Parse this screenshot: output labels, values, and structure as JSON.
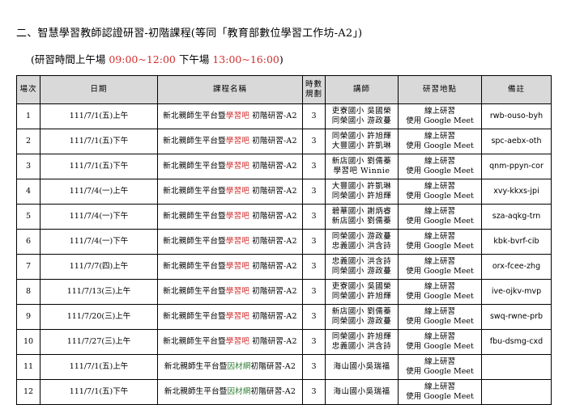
{
  "heading": "二、智慧學習教師認證研習-初階課程(等同「教育部數位學習工作坊-A2」)",
  "time_note": {
    "prefix": "(研習時間上午場 ",
    "morning": "09:00~12:00",
    "middle": " 下午場 ",
    "afternoon": "13:00~16:00",
    "suffix": ")"
  },
  "colors": {
    "red_text": "#d22d2d",
    "green_text": "#2e7d32",
    "header_bg": "#d9d9d9"
  },
  "table": {
    "headers": {
      "no": "場次",
      "date": "日期",
      "course": "課程名稱",
      "hours_1": "時數",
      "hours_2": "規劃",
      "teacher": "講師",
      "location": "研習地點",
      "note": "備註"
    },
    "rows": [
      {
        "no": "1",
        "date": "111/7/1(五)上午",
        "course_pre": "新北親師生平台暨",
        "course_kw": "學習吧",
        "course_post": " 初階研習-A2",
        "kw_color": "red",
        "hours": "3",
        "t1": "吏寮國小 吳國榮",
        "t2": "同榮國小 游政蔓",
        "l1": "線上研習",
        "l2": "使用 Google Meet",
        "note": "rwb-ouso-byh"
      },
      {
        "no": "2",
        "date": "111/7/1(五)下午",
        "course_pre": "新北親師生平台暨",
        "course_kw": "學習吧",
        "course_post": " 初階研習-A2",
        "kw_color": "red",
        "hours": "3",
        "t1": "同榮國小 許旭輝",
        "t2": "大豐國小 許凱琳",
        "l1": "線上研習",
        "l2": "使用 Google Meet",
        "note": "spc-aebx-oth"
      },
      {
        "no": "3",
        "date": "111/7/1(五)下午",
        "course_pre": "新北親師生平台暨",
        "course_kw": "學習吧",
        "course_post": " 初階研習-A2",
        "kw_color": "red",
        "hours": "3",
        "t1": "新店國小 劉儒蓁",
        "t2": "學習吧 Winnie",
        "l1": "線上研習",
        "l2": "使用 Google Meet",
        "note": "qnm-ppyn-cor"
      },
      {
        "no": "4",
        "date": "111/7/4(一)上午",
        "course_pre": "新北親師生平台暨",
        "course_kw": "學習吧",
        "course_post": " 初階研習-A2",
        "kw_color": "red",
        "hours": "3",
        "t1": "大豐國小 許凱琳",
        "t2": "同榮國小 許旭輝",
        "l1": "線上研習",
        "l2": "使用 Google Meet",
        "note": "xvy-kkxs-jpi"
      },
      {
        "no": "5",
        "date": "111/7/4(一)下午",
        "course_pre": "新北親師生平台暨",
        "course_kw": "學習吧",
        "course_post": " 初階研習-A2",
        "kw_color": "red",
        "hours": "3",
        "t1": "碧華國小 謝炳睿",
        "t2": "新店國小 劉儒蓁",
        "l1": "線上研習",
        "l2": "使用 Google Meet",
        "note": "sza-aqkg-trn"
      },
      {
        "no": "6",
        "date": "111/7/4(一)下午",
        "course_pre": "新北親師生平台暨",
        "course_kw": "學習吧",
        "course_post": " 初階研習-A2",
        "kw_color": "red",
        "hours": "3",
        "t1": "同榮國小 游政蔓",
        "t2": "忠義國小 洪含詩",
        "l1": "線上研習",
        "l2": "使用 Google Meet",
        "note": "kbk-bvrf-cib"
      },
      {
        "no": "7",
        "date": "111/7/7(四)上午",
        "course_pre": "新北親師生平台暨",
        "course_kw": "學習吧",
        "course_post": " 初階研習-A2",
        "kw_color": "red",
        "hours": "3",
        "t1": "忠義國小 洪含詩",
        "t2": "同榮國小 游政蔓",
        "l1": "線上研習",
        "l2": "使用 Google Meet",
        "note": "orx-fcee-zhg"
      },
      {
        "no": "8",
        "date": "111/7/13(三)上午",
        "course_pre": "新北親師生平台暨",
        "course_kw": "學習吧",
        "course_post": " 初階研習-A2",
        "kw_color": "red",
        "hours": "3",
        "t1": "吏寮國小 吳國榮",
        "t2": "同榮國小 許旭輝",
        "l1": "線上研習",
        "l2": "使用 Google Meet",
        "note": "ive-ojkv-mvp"
      },
      {
        "no": "9",
        "date": "111/7/20(三)上午",
        "course_pre": "新北親師生平台暨",
        "course_kw": "學習吧",
        "course_post": " 初階研習-A2",
        "kw_color": "red",
        "hours": "3",
        "t1": "新店國小 劉儒蓁",
        "t2": "同榮國小 游政蔓",
        "l1": "線上研習",
        "l2": "使用 Google Meet",
        "note": "swq-rwne-prb"
      },
      {
        "no": "10",
        "date": "111/7/27(三)上午",
        "course_pre": "新北親師生平台暨",
        "course_kw": "學習吧",
        "course_post": " 初階研習-A2",
        "kw_color": "red",
        "hours": "3",
        "t1": "同榮國小 許旭輝",
        "t2": "忠義國小 洪含詩",
        "l1": "線上研習",
        "l2": "使用 Google Meet",
        "note": "fbu-dsmg-cxd"
      },
      {
        "no": "11",
        "date": "111/7/1(五)上午",
        "course_pre": "新北親師生平台暨",
        "course_kw": "因材網",
        "course_post": "初階研習-A2",
        "kw_color": "green",
        "hours": "3",
        "t1": "海山國小吳瑞福",
        "t2": "",
        "l1": "線上研習",
        "l2": "使用 Google Meet",
        "note": ""
      },
      {
        "no": "12",
        "date": "111/7/1(五)下午",
        "course_pre": "新北親師生平台暨",
        "course_kw": "因材網",
        "course_post": "初階研習-A2",
        "kw_color": "green",
        "hours": "3",
        "t1": "海山國小吳瑞福",
        "t2": "",
        "l1": "線上研習",
        "l2": "使用 Google Meet",
        "note": ""
      }
    ]
  }
}
